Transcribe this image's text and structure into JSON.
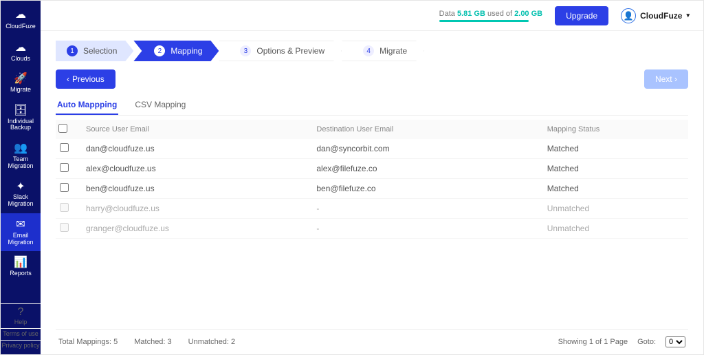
{
  "brand": {
    "name": "CloudFuze"
  },
  "sidebar": {
    "items": [
      {
        "label": "Clouds"
      },
      {
        "label": "Migrate"
      },
      {
        "label": "Individual\nBackup"
      },
      {
        "label": "Team\nMigration"
      },
      {
        "label": "Slack\nMigration"
      },
      {
        "label": "Email\nMigration"
      },
      {
        "label": "Reports"
      }
    ],
    "footer": [
      {
        "label": "Help"
      },
      {
        "label": "Terms of use"
      },
      {
        "label": "Privacy policy"
      }
    ]
  },
  "topbar": {
    "data_prefix": "Data ",
    "data_used": "5.81 GB",
    "data_mid": " used of ",
    "data_total": "2.00 GB",
    "upgrade": "Upgrade",
    "user": "CloudFuze"
  },
  "stepper": [
    {
      "num": "1",
      "label": "Selection"
    },
    {
      "num": "2",
      "label": "Mapping"
    },
    {
      "num": "3",
      "label": "Options & Preview"
    },
    {
      "num": "4",
      "label": "Migrate"
    }
  ],
  "actions": {
    "previous": "Previous",
    "next": "Next"
  },
  "tabs": [
    {
      "label": "Auto Mappping"
    },
    {
      "label": "CSV Mapping"
    }
  ],
  "table": {
    "headers": {
      "source": "Source User Email",
      "dest": "Destination User Email",
      "status": "Mapping Status"
    },
    "rows": [
      {
        "source": "dan@cloudfuze.us",
        "dest": "dan@syncorbit.com",
        "status": "Matched",
        "enabled": true
      },
      {
        "source": "alex@cloudfuze.us",
        "dest": "alex@filefuze.co",
        "status": "Matched",
        "enabled": true
      },
      {
        "source": "ben@cloudfuze.us",
        "dest": "ben@filefuze.co",
        "status": "Matched",
        "enabled": true
      },
      {
        "source": "harry@cloudfuze.us",
        "dest": "-",
        "status": "Unmatched",
        "enabled": false
      },
      {
        "source": "granger@cloudfuze.us",
        "dest": "-",
        "status": "Unmatched",
        "enabled": false
      }
    ]
  },
  "footer": {
    "totalLabel": "Total Mappings: ",
    "total": "5",
    "matchedLabel": "Matched: ",
    "matched": "3",
    "unmatchedLabel": "Unmatched: ",
    "unmatched": "2",
    "pager": "Showing 1 of 1 Page",
    "gotoLabel": "Goto:",
    "gotoValue": "0"
  }
}
